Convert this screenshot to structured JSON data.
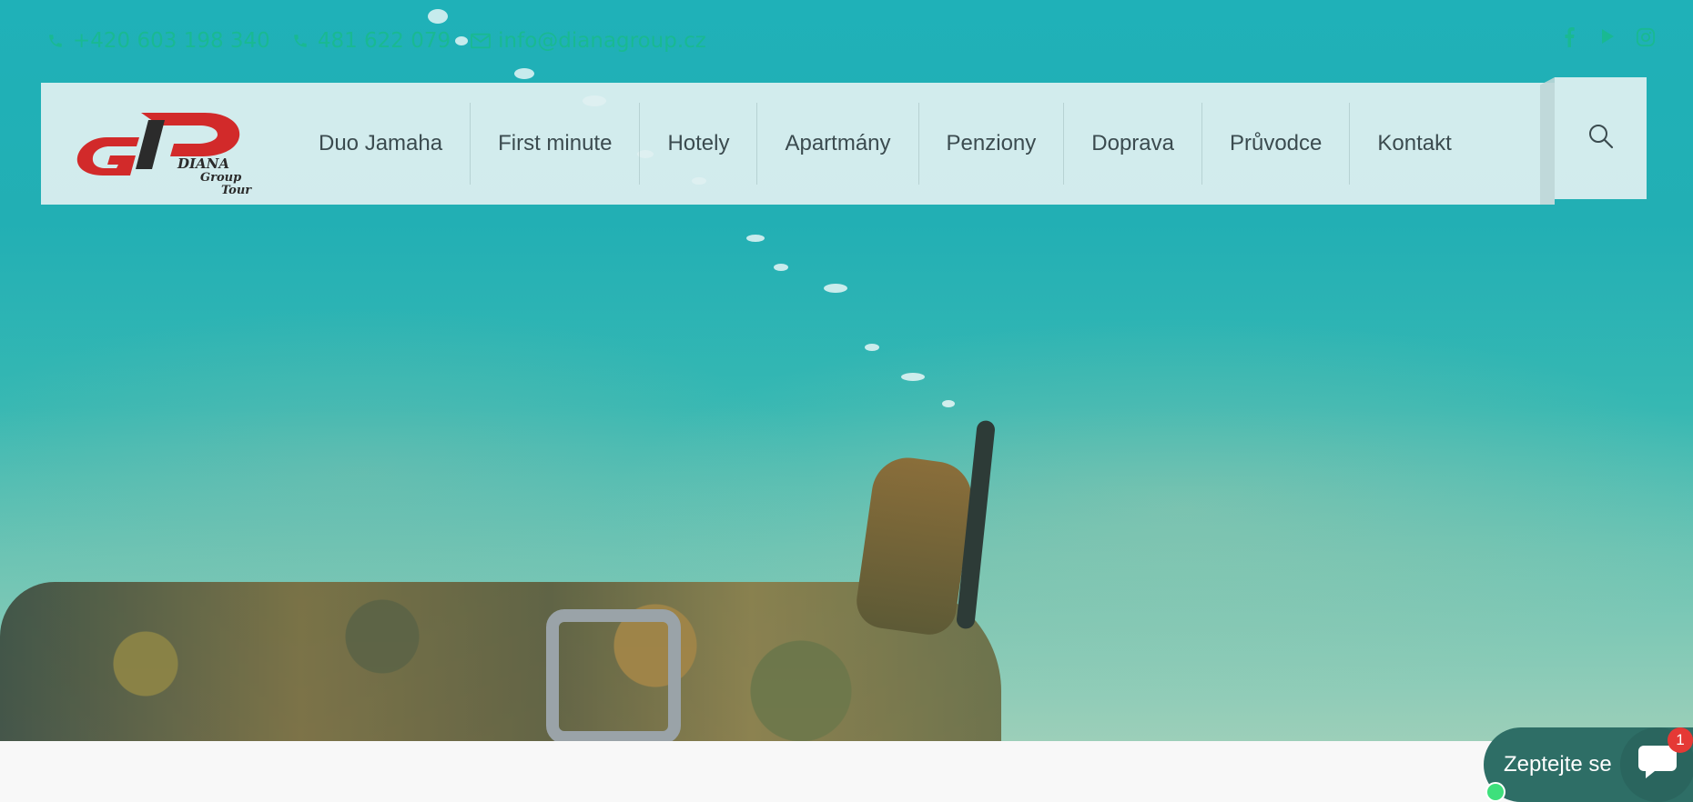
{
  "topbar": {
    "phone1": "+420 603 198 340",
    "phone2": "481 622 079",
    "email": "info@dianagroup.cz",
    "icons": {
      "phone": "phone-icon",
      "mail": "mail-icon"
    },
    "social": [
      "facebook-icon",
      "youtube-icon",
      "instagram-icon"
    ]
  },
  "logo": {
    "line1": "DIANA",
    "line2": "Group",
    "line3": "Tour"
  },
  "nav": {
    "items": [
      {
        "label": "Duo Jamaha"
      },
      {
        "label": "First minute"
      },
      {
        "label": "Hotely"
      },
      {
        "label": "Apartmány"
      },
      {
        "label": "Penziony"
      },
      {
        "label": "Doprava"
      },
      {
        "label": "Průvodce"
      },
      {
        "label": "Kontakt"
      }
    ],
    "search_icon": "search-icon"
  },
  "chat": {
    "label": "Zeptejte se",
    "badge": "1"
  },
  "colors": {
    "accent": "#19b992",
    "nav_text": "#3b4b4f",
    "chat_bg": "#2e6e66",
    "badge": "#e53935"
  }
}
